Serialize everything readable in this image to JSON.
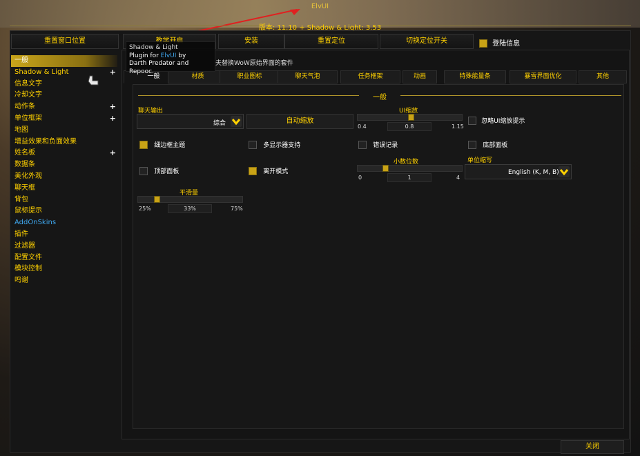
{
  "window": {
    "title": "ElvUI",
    "version": "版本: 11.10 + Shadow & Light: 3.53"
  },
  "topbar": {
    "reset_positions": "重置窗口位置",
    "hidden_tab": "教学开启",
    "install": "安装",
    "reset_anchor": "重置定位",
    "toggle_anchors": "切换定位开关",
    "login_message": "登陆信息",
    "login_checked": true
  },
  "tooltip": {
    "line1": "Shadow & Light",
    "line2_prefix": "Plugin for ",
    "line2_link": "ElvUI",
    "line2_suffix": " by",
    "line3": "Darth Predator and Repooc."
  },
  "hint": "夫替换WoW原始界面的套件",
  "sidebar": {
    "items": [
      {
        "label": "一般",
        "selected": true,
        "plus": false,
        "blue": false
      },
      {
        "label": "Shadow & Light",
        "selected": false,
        "plus": true,
        "blue": false
      },
      {
        "label": "信息文字",
        "plus": false
      },
      {
        "label": "冷却文字",
        "plus": false
      },
      {
        "label": "动作条",
        "plus": true
      },
      {
        "label": "单位框架",
        "plus": true
      },
      {
        "label": "地图",
        "plus": false
      },
      {
        "label": "增益效果和负面效果",
        "plus": false
      },
      {
        "label": "姓名板",
        "plus": true
      },
      {
        "label": "数据条",
        "plus": false
      },
      {
        "label": "美化外观",
        "plus": false
      },
      {
        "label": "聊天框",
        "plus": false
      },
      {
        "label": "背包",
        "plus": false
      },
      {
        "label": "鼠标提示",
        "plus": false
      },
      {
        "label": "AddOnSkins",
        "plus": false,
        "blue": true
      },
      {
        "label": "插件",
        "plus": false
      },
      {
        "label": "过滤器",
        "plus": false
      },
      {
        "label": "配置文件",
        "plus": false
      },
      {
        "label": "模块控制",
        "plus": false
      },
      {
        "label": "鸣谢",
        "plus": false
      }
    ]
  },
  "tabs": [
    "一般",
    "材质",
    "职业图标",
    "聊天气泡",
    "任务框架",
    "动画",
    "特殊能量条",
    "暴雪界面优化",
    "其他"
  ],
  "section": {
    "title": "一般"
  },
  "options": {
    "chat_output_label": "聊天输出",
    "chat_output_value": "综合",
    "auto_scale": "自动缩放",
    "ui_scale": {
      "label": "UI缩放",
      "min": "0.4",
      "value": "0.8",
      "max": "1.15",
      "fraction": 0.51
    },
    "ignore_scale_popup": {
      "label": "忽略UI缩放提示",
      "checked": false
    },
    "thin_border": {
      "label": "细边框主题",
      "checked": true
    },
    "multi_monitor": {
      "label": "多显示器支持",
      "checked": false
    },
    "log_errors": {
      "label": "错误记录",
      "checked": false
    },
    "bottom_panel": {
      "label": "底部面板",
      "checked": false
    },
    "top_panel": {
      "label": "顶部面板",
      "checked": false
    },
    "afk_mode": {
      "label": "离开模式",
      "checked": true
    },
    "decimal": {
      "label": "小数位数",
      "min": "0",
      "value": "1",
      "max": "4",
      "fraction": 0.25
    },
    "unit_prefix": {
      "label": "单位缩写",
      "value": "English (K, M, B)"
    },
    "smoothing": {
      "label": "平滑量",
      "min": "25%",
      "value": "33%",
      "max": "75%",
      "fraction": 0.16
    }
  },
  "close": "关闭"
}
